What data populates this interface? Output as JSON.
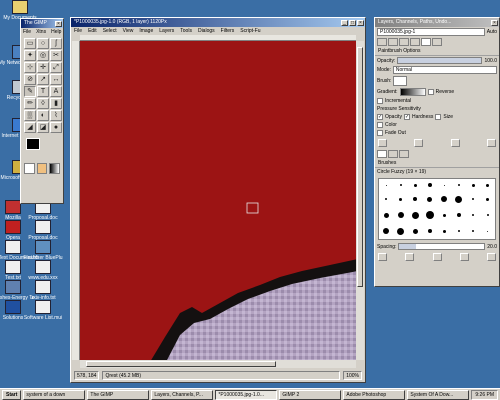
{
  "desktop": {
    "icons": [
      {
        "label": "My Documents",
        "color": "#e8d070"
      },
      {
        "label": "My Network Places",
        "color": "#4a80c0"
      },
      {
        "label": "Recycle Bin",
        "color": "#c0c8d0"
      },
      {
        "label": "Internet Explorer",
        "color": "#3a7ad0"
      },
      {
        "label": "Microsoft Outlook",
        "color": "#d0b040"
      },
      {
        "label": "Mozilla",
        "color": "#c03030"
      },
      {
        "label": "Proposal.doc",
        "color": "#f0f0f0"
      },
      {
        "label": "Opera",
        "color": "#c02020"
      },
      {
        "label": "Proposal.doc",
        "color": "#f0f0f0"
      },
      {
        "label": "New Text Document.txt",
        "color": "#f0f0f0"
      },
      {
        "label": "Flashfxer BluePlu",
        "color": "#6090c0"
      },
      {
        "label": "Test.txt",
        "color": "#f0f0f0"
      },
      {
        "label": "www.edu.xxx",
        "color": "#f0f0f0"
      },
      {
        "label": "toolbrshes-Energy Te...",
        "color": "#6080b0"
      },
      {
        "label": "uxiv-info.txt",
        "color": "#f0f0f0"
      },
      {
        "label": "Solutions",
        "color": "#2050a0"
      },
      {
        "label": "Software List.mui",
        "color": "#f0f0f0"
      }
    ]
  },
  "toolbox": {
    "title": "The GIMP",
    "menu": [
      "File",
      "Xtns",
      "Help"
    ],
    "tools": [
      "▭",
      "○",
      "ʃ",
      "✦",
      "◎",
      "✂",
      "⊹",
      "✛",
      "⤢",
      "⊘",
      "↗",
      "↔",
      "✎",
      "T",
      "A",
      "✏",
      "◊",
      "▮",
      "▒",
      "◐",
      "⌇",
      "◢",
      "◪",
      "●"
    ]
  },
  "image_window": {
    "title": "*P1000035.jpg-1.0 (RGB, 1 layer) 1120Px",
    "menu": [
      "File",
      "Edit",
      "Select",
      "View",
      "Image",
      "Layers",
      "Tools",
      "Dialogs",
      "Filters",
      "Script-Fu"
    ],
    "zoom": "100%",
    "coords": "578, 184",
    "status": "Qrest (45.2 MB)",
    "colors": {
      "red": "#9c1414",
      "dark": "#141010",
      "stone": "#b8a8c4"
    }
  },
  "dock": {
    "title": "Layers, Channels, Paths, Undo...",
    "image_combo": "P1000035.jpg-1",
    "auto_label": "Auto",
    "paint_title": "Paintbrush Options",
    "opacity_label": "Opacity:",
    "opacity_value": "100.0",
    "mode_label": "Mode:",
    "mode_value": "Normal",
    "brush_label": "Brush:",
    "gradient_label": "Gradient:",
    "reverse_label": "Reverse",
    "incremental_label": "Incremental",
    "pressure_label": "Pressure Sensitivity",
    "p_opacity": "Opacity",
    "p_hardness": "Hardness",
    "p_size": "Size",
    "color_label": "Color",
    "fade_label": "Fade Out",
    "brushes_title": "Brushes",
    "brush_name": "Circle Fuzzy (19 × 19)",
    "spacing_label": "Spacing:",
    "spacing_value": "20.0"
  },
  "taskbar": {
    "start": "Start",
    "tasks": [
      "system of a down",
      "The GIMP",
      "Layers, Channels, P...",
      "*P1000035.jpg-1.0...",
      "GIMP 2",
      "Adobe Photoshop",
      "System Of A Dow..."
    ],
    "clock": "9:26 PM"
  }
}
